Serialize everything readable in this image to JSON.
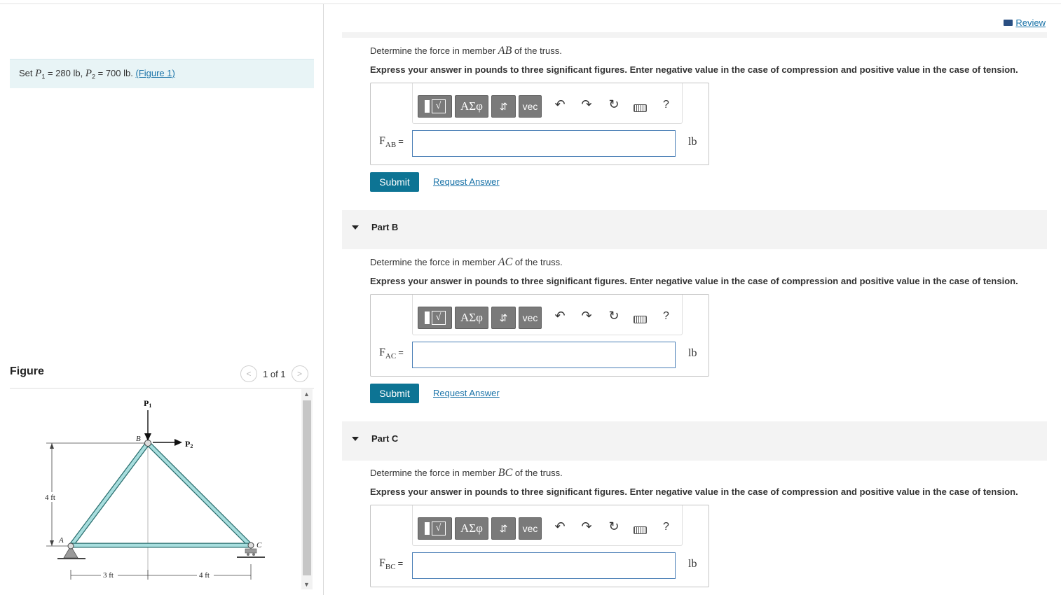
{
  "review": {
    "label": "Review",
    "icon": "book-icon"
  },
  "given": {
    "prefix": "Set",
    "p1_symbol": "P",
    "p1_sub": "1",
    "p1_value": " = 280 lb,",
    "p2_symbol": "P",
    "p2_sub": "2",
    "p2_value": " = 700 lb.",
    "figure_link": "(Figure 1)"
  },
  "figure": {
    "title": "Figure",
    "pager": "1 of 1",
    "labels": {
      "p1": "P",
      "p1_sub": "1",
      "p2": "P",
      "p2_sub": "2",
      "node_a": "A",
      "node_b": "B",
      "node_c": "C",
      "height": "4 ft",
      "left_span": "3 ft",
      "right_span": "4 ft"
    },
    "colors": {
      "member": "#a8dede",
      "member_edge": "#2a6f6f"
    }
  },
  "parts": [
    {
      "header": "",
      "question_prefix": "Determine the force in member ",
      "member": "AB",
      "question_suffix": " of the truss.",
      "instruction": "Express your answer in pounds to three significant figures. Enter negative value in the case of compression and positive value in the case of tension.",
      "var": "F",
      "var_sub": "AB",
      "eq": "=",
      "value": "",
      "unit": "lb",
      "submit": "Submit",
      "request": "Request Answer"
    },
    {
      "header": "Part B",
      "question_prefix": "Determine the force in member ",
      "member": "AC",
      "question_suffix": " of the truss.",
      "instruction": "Express your answer in pounds to three significant figures. Enter negative value in the case of compression and positive value in the case of tension.",
      "var": "F",
      "var_sub": "AC",
      "eq": "=",
      "value": "",
      "unit": "lb",
      "submit": "Submit",
      "request": "Request Answer"
    },
    {
      "header": "Part C",
      "question_prefix": "Determine the force in member ",
      "member": "BC",
      "question_suffix": " of the truss.",
      "instruction": "Express your answer in pounds to three significant figures. Enter negative value in the case of compression and positive value in the case of tension.",
      "var": "F",
      "var_sub": "BC",
      "eq": "=",
      "value": "",
      "unit": "lb"
    }
  ],
  "toolbar": {
    "greek": "ΑΣφ",
    "arrows": "⇵",
    "vec": "vec",
    "undo": "↶",
    "redo": "↷",
    "reset": "↻",
    "help": "?",
    "sqrt_glyph": "√",
    "sqrt_box": "□"
  }
}
